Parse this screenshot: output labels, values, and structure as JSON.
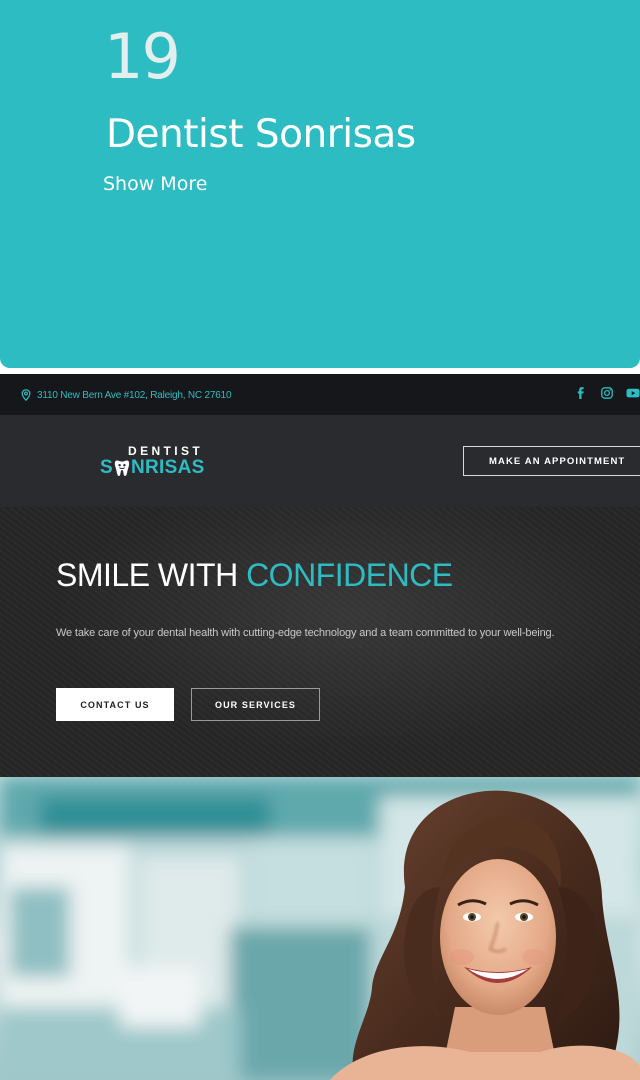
{
  "card": {
    "number": "19",
    "title": "Dentist Sonrisas",
    "show_more": "Show More"
  },
  "site": {
    "address": "3110 New Bern Ave #102, Raleigh, NC 27610",
    "social_icons": [
      "facebook-icon",
      "instagram-icon",
      "youtube-icon"
    ],
    "logo": {
      "top": "DENTIST",
      "bottom_prefix": "S",
      "bottom_suffix": "NRISAS"
    },
    "appointment_button": "MAKE AN APPOINTMENT",
    "hero": {
      "title_part1": "SMILE WITH ",
      "title_part2": "CONFIDENCE",
      "subtitle": "We take care of your dental health with cutting-edge technology and a team committed to your well-being.",
      "contact_button": "CONTACT US",
      "services_button": "OUR SERVICES"
    }
  },
  "colors": {
    "accent": "#2ebcc3",
    "dark_bg": "#262626",
    "nav_bg": "#2a2b2f"
  }
}
